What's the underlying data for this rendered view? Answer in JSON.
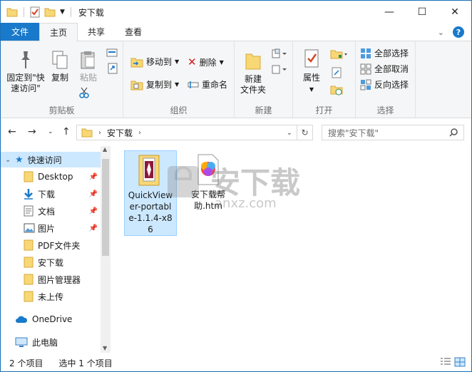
{
  "window": {
    "title": "安下载",
    "minimize": "—",
    "maximize": "☐",
    "close": "✕"
  },
  "tabs": {
    "file": "文件",
    "home": "主页",
    "share": "共享",
    "view": "查看"
  },
  "ribbon": {
    "clipboard": {
      "pin_label": "固定到\"快\n速访问\"",
      "copy_label": "复制",
      "paste_label": "粘贴",
      "group_label": "剪贴板"
    },
    "organize": {
      "move_to": "移动到",
      "copy_to": "复制到",
      "delete": "删除",
      "rename": "重命名",
      "group_label": "组织"
    },
    "new": {
      "new_folder": "新建\n文件夹",
      "group_label": "新建"
    },
    "open": {
      "properties": "属性",
      "group_label": "打开"
    },
    "select": {
      "select_all": "全部选择",
      "select_none": "全部取消",
      "invert": "反向选择",
      "group_label": "选择"
    }
  },
  "address": {
    "path": "安下载",
    "search_placeholder": "搜索\"安下载\""
  },
  "nav": {
    "items": [
      {
        "label": "快速访问",
        "pinned": false
      },
      {
        "label": "Desktop",
        "pinned": true
      },
      {
        "label": "下载",
        "pinned": true
      },
      {
        "label": "文档",
        "pinned": true
      },
      {
        "label": "图片",
        "pinned": true
      },
      {
        "label": "PDF文件夹",
        "pinned": false
      },
      {
        "label": "安下载",
        "pinned": false
      },
      {
        "label": "图片管理器",
        "pinned": false
      },
      {
        "label": "未上传",
        "pinned": false
      },
      {
        "label": "OneDrive",
        "pinned": false
      },
      {
        "label": "此电脑",
        "pinned": false
      }
    ]
  },
  "files": [
    {
      "name": "QuickViewer-portable-1.1.4-x86",
      "line1": "QuickView",
      "line2": "er-portabl",
      "line3": "e-1.1.4-x8",
      "line4": "6"
    },
    {
      "name": "安下载帮助.htm",
      "line1": "安下载帮",
      "line2": "助.htm"
    }
  ],
  "status": {
    "item_count": "2 个项目",
    "selected": "选中 1 个项目"
  },
  "watermark": {
    "text": "安下载",
    "sub": "anxz.com"
  },
  "colors": {
    "accent": "#1979ca",
    "selection": "#cce8ff",
    "folder": "#f8d775"
  }
}
